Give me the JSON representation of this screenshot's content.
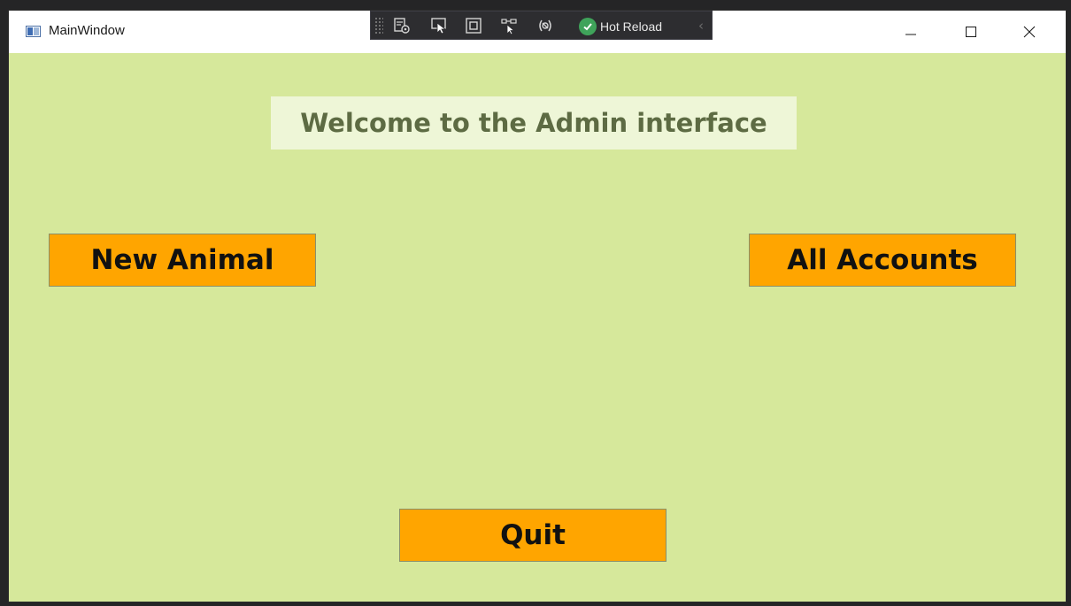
{
  "window": {
    "title": "MainWindow"
  },
  "debug_toolbar": {
    "icons": [
      "live-visual-tree-icon",
      "select-element-icon",
      "display-layout-adorners-icon",
      "track-focus-icon",
      "binding-failures-icon"
    ],
    "hot_reload_label": "Hot Reload",
    "hot_reload_status_color": "#3fa35a"
  },
  "window_controls": {
    "minimize": "minimize-icon",
    "maximize": "maximize-icon",
    "close": "close-icon"
  },
  "main": {
    "welcome_text": "Welcome to the Admin interface",
    "buttons": {
      "new_animal": "New Animal",
      "all_accounts": "All Accounts",
      "quit": "Quit"
    }
  },
  "colors": {
    "background": "#d6e89b",
    "button": "#ffa500",
    "welcome_box": "#eef6d7",
    "welcome_text": "#5d6b43"
  }
}
